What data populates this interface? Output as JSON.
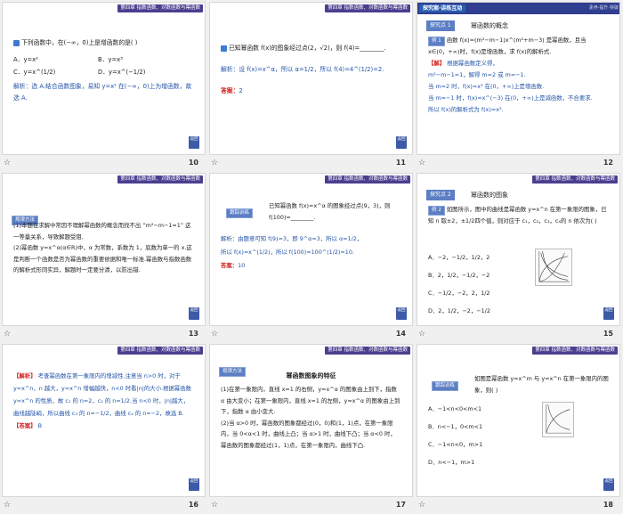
{
  "header_label": "第四章  指数函数、对数函数与幂函数",
  "slides": [
    {
      "num": "10",
      "q": "下列函数中，在(−∞，0)上是增函数的是(    )",
      "opts": [
        "A．y=x²",
        "B．y=x³",
        "C．y=x^(1/2)",
        "D．y=x^(−1/2)"
      ],
      "ans": "解析：选 A.结合函数图象，易知 y=x² 在(−∞，0)上为增函数，故选 A."
    },
    {
      "num": "11",
      "q": "已知幂函数 f(x)的图象经过点(2，√2)，则 f(4)=________.",
      "sol1": "解析：设 f(x)=x^α，所以 α=1/2，所以 f(4)=4^(1/2)=2.",
      "ans_label": "答案：",
      "ans": "2"
    },
    {
      "num": "12",
      "banner": "探究案·讲练互动",
      "banner_sub": "素养·提升·突破",
      "section": "探究点 1",
      "section_title": "幂函数的概念",
      "ex_tag": "例 1",
      "ex_text": "函数 f(x)=(m²−m−1)x^(m²+m−3) 是幂函数，且当 x∈(0，+∞)时，f(x)是增函数，求 f(x)的解析式.",
      "sol_tag": "【解】",
      "sol_lines": [
        "根据幂函数定义得，",
        "m²−m−1=1，解得 m=2 或 m=−1.",
        "当 m=2 时，f(x)=x³ 在(0，+∞)上是增函数.",
        "当 m=−1 时，f(x)=x^(−3) 在(0，+∞)上是减函数，不合要求.",
        "所以 f(x)的解析式为 f(x)=x³."
      ]
    },
    {
      "num": "13",
      "box": "规律方法",
      "lines": [
        "(1)本题在求解中常因不理解幂函数的概念而找不出 “m²−m−1=1” 这一等量关系，导致解题受阻.",
        "(2)幂函数 y=x^α(α∈R)中，α 为常数，系数为 1，底数为单一的 x.这是判断一个函数是否为幂函数的重要依据和唯一标准.幂函数与指数函数的解析式形同实异，解题时一定要分清，以防出错."
      ]
    },
    {
      "num": "14",
      "box": "跟踪训练",
      "q": "已知幂函数 f(x)=x^α 的图象经过点(9，3)，则 f(100)=________.",
      "sol1": "解析：由题意可知 f(9)=3，即 9^α=3，所以 α=1/2，",
      "sol2": "所以 f(x)=x^(1/2)，所以 f(100)=100^(1/2)=10.",
      "ans_label": "答案：",
      "ans": "10"
    },
    {
      "num": "15",
      "section": "探究点 2",
      "section_title": "幂函数的图象",
      "ex_tag": "例 2",
      "ex_text": "如图所示，图中的曲线是幂函数 y=x^n 在第一象限的图象，已知 n 取±2，±1/2四个值，则对应于 c₁，c₂，c₃，c₄的 n 依次为(    )",
      "opts": [
        "A．−2，−1/2，1/2，2",
        "B．2，1/2，−1/2，−2",
        "C．−1/2，−2，2，1/2",
        "D．2，1/2，−2，−1/2"
      ]
    },
    {
      "num": "16",
      "sol_tag": "【解析】",
      "lines": [
        "考查幂函数在第一象限内的增减性.注意当 n>0 时，对于 y=x^n，n 越大，y=x^n 增幅越快，n<0 时看|n|的大小.根据幂函数 y=x^n 的性质，故 c₁ 的 n=2，c₂ 的 n=1/2.当 n<0 时，|n|越大，曲线越陡峭，所以曲线 c₃ 的 n=−1/2，曲线 c₄ 的 n=−2，故选 B."
      ],
      "ans_tag": "【答案】",
      "ans": "B"
    },
    {
      "num": "17",
      "box": "规律方法",
      "title": "幂函数图象的特征",
      "lines": [
        "(1)在第一象限内，直线 x=1 的右侧，y=x^α 的图象由上到下，指数 α 由大变小；在第一象限内，直线 x=1 的左侧，y=x^α 的图象由上到下，指数 α 由小变大.",
        "(2)当 α>0 时，幂函数的图象都经过(0，0)和(1，1)点，在第一象限内，当 0<α<1 时，曲线上凸；当 α>1 时，曲线下凸；当 α<0 时，幂函数的图象都经过(1，1)点，在第一象限内，曲线下凸."
      ]
    },
    {
      "num": "18",
      "box": "跟踪训练",
      "q": "如图是幂函数 y=x^m 与 y=x^n 在第一象限内的图象，则(    )",
      "opts": [
        "A．−1<n<0<m<1",
        "B．n<−1，0<m<1",
        "C．−1<n<0，m>1",
        "D．n<−1，m>1"
      ]
    }
  ],
  "nav_star": "☆",
  "return_label": "返回",
  "colors": {
    "header": "#4a3f8f",
    "accent": "#2253a8",
    "red": "#d21e1e",
    "banner": "#2f3e8f"
  }
}
